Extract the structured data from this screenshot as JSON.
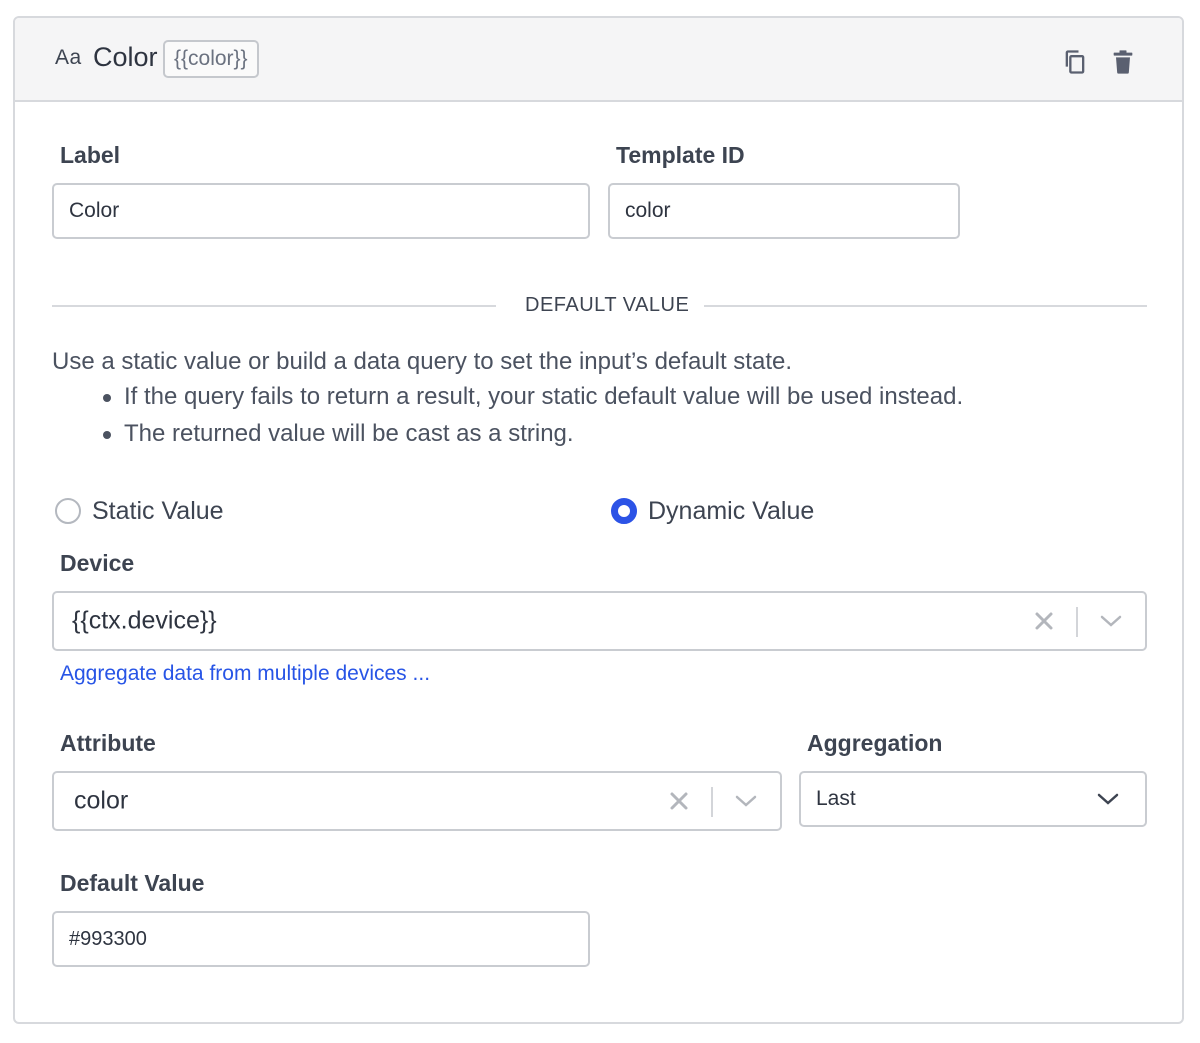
{
  "header": {
    "type_icon_text": "Aa",
    "title": "Color",
    "template_badge": "{{color}}"
  },
  "fields": {
    "label": {
      "label": "Label",
      "value": "Color"
    },
    "template_id": {
      "label": "Template ID",
      "value": "color"
    }
  },
  "default_section": {
    "heading": "DEFAULT VALUE",
    "description": "Use a static value or build a data query to set the input’s default state.",
    "bullets": [
      "If the query fails to return a result, your static default value will be used instead.",
      "The returned value will be cast as a string."
    ],
    "radio_static": "Static Value",
    "radio_dynamic": "Dynamic Value",
    "selected": "Dynamic Value"
  },
  "device": {
    "label": "Device",
    "value": "{{ctx.device}}",
    "aggregate_link": "Aggregate data from multiple devices ..."
  },
  "attribute": {
    "label": "Attribute",
    "value": "color"
  },
  "aggregation": {
    "label": "Aggregation",
    "value": "Last"
  },
  "default_value": {
    "label": "Default Value",
    "value": "#993300"
  },
  "colors": {
    "accent": "#2c53e6",
    "link": "#2754e6",
    "border": "#c9ccd1"
  }
}
